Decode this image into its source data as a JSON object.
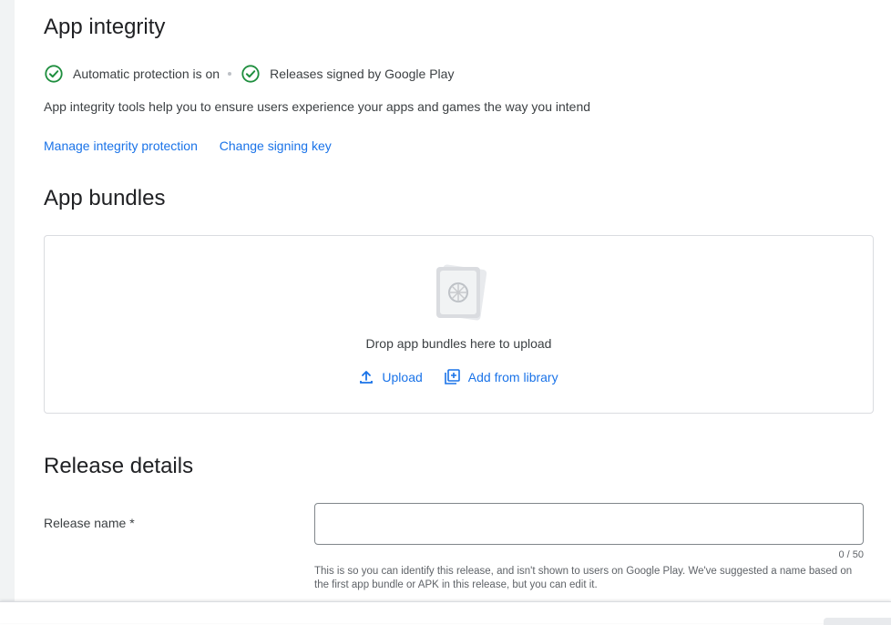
{
  "integrity": {
    "title": "App integrity",
    "status": [
      {
        "label": "Automatic protection is on",
        "icon": "check-circle-icon"
      },
      {
        "label": "Releases signed by Google Play",
        "icon": "check-circle-icon"
      }
    ],
    "description": "App integrity tools help you to ensure users experience your apps and games the way you intend",
    "links": [
      "Manage integrity protection",
      "Change signing key"
    ]
  },
  "bundles": {
    "title": "App bundles",
    "drop_text": "Drop app bundles here to upload",
    "upload_label": "Upload",
    "library_label": "Add from library"
  },
  "details": {
    "title": "Release details",
    "name_label": "Release name",
    "required_mark": "*",
    "name_value": "",
    "counter": "0 / 50",
    "helper": "This is so you can identify this release, and isn't shown to users on Google Play. We've suggested a name based on the first app bundle or APK in this release, but you can edit it."
  },
  "colors": {
    "accent": "#1a73e8",
    "success": "#1e8e3e"
  }
}
